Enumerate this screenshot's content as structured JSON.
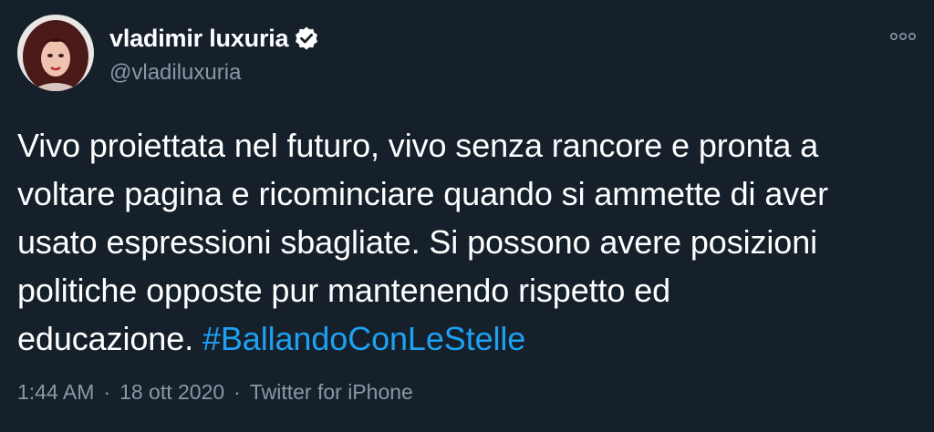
{
  "author": {
    "display_name": "vladimir luxuria",
    "handle": "@vladiluxuria",
    "verified_icon": "verified-badge-icon"
  },
  "tweet": {
    "text_lines": [
      "Vivo proiettata nel futuro, vivo senza rancore e pronta a",
      "voltare pagina e ricominciare quando si ammette di aver",
      "usato espressioni sbagliate. Si possono avere posizioni",
      "politiche opposte pur mantenendo rispetto ed"
    ],
    "last_line_text": "educazione. ",
    "hashtag": "#BallandoConLeStelle"
  },
  "meta": {
    "time": "1:44 AM",
    "separator": "·",
    "date": "18 ott 2020",
    "source": "Twitter for iPhone"
  },
  "colors": {
    "background": "#15202b",
    "text": "#ffffff",
    "secondary": "#8899a6",
    "link": "#1da1f2"
  }
}
